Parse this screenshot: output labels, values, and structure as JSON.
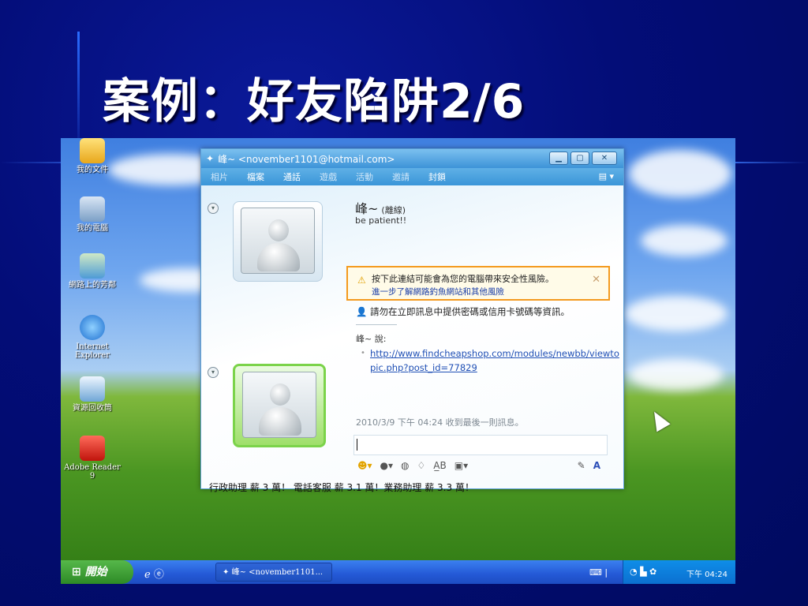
{
  "slide": {
    "title": "案例：好友陷阱2/6"
  },
  "desktop": {
    "icons": [
      {
        "label": "我的文件"
      },
      {
        "label": "我的電腦"
      },
      {
        "label": "網路上的芳鄰"
      },
      {
        "label": "Internet Explorer"
      },
      {
        "label": "資源回收筒"
      },
      {
        "label": "Adobe Reader 9"
      }
    ]
  },
  "window": {
    "title": "峰~ <november1101@hotmail.com>",
    "menu": [
      "相片",
      "檔案",
      "通話",
      "遊戲",
      "活動",
      "邀請",
      "封鎖"
    ],
    "contact_name": "峰~",
    "contact_status": "(離線)",
    "contact_message": "be patient!!",
    "warning_main": "按下此連結可能會為您的電腦帶來安全性風險。",
    "warning_link": "進一步了解網路釣魚網站和其他風險",
    "safety_note": "請勿在立即訊息中提供密碼或信用卡號碼等資訊。",
    "sender_line": "峰~ 說:",
    "link_text": "http://www.findcheapshop.com/modules/newbb/viewtopic.php?post_id=77829",
    "last_message": "2010/3/9 下午 04:24 收到最後一則訊息。",
    "ad_text": "行政助理 薪 3 萬！ 電話客服 薪 3.1 萬！業務助理 薪 3.3 萬！"
  },
  "taskbar": {
    "start_label": "開始",
    "task_button": "峰~ <november1101...",
    "clock": "下午 04:24"
  },
  "colors": {
    "slide_bg": "#000a6e",
    "warning_border": "#f49a1e",
    "link": "#1f4fb5"
  }
}
